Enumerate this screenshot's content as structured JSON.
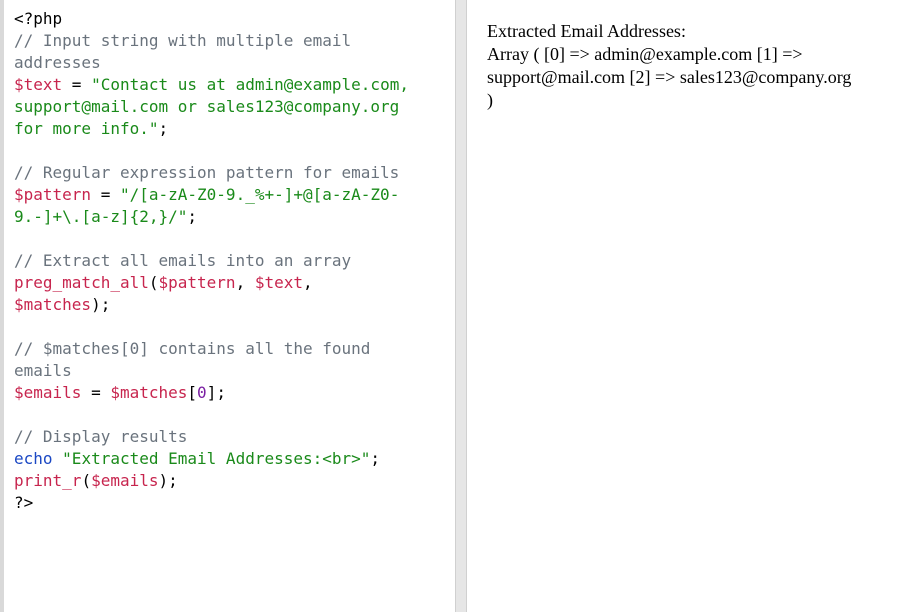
{
  "code_lines": [
    [
      {
        "t": "<?php",
        "c": "plain"
      }
    ],
    [
      {
        "t": "// Input string with multiple email",
        "c": "comment"
      }
    ],
    [
      {
        "t": "addresses",
        "c": "comment"
      }
    ],
    [
      {
        "t": "$text",
        "c": "var"
      },
      {
        "t": " = ",
        "c": "plain"
      },
      {
        "t": "\"Contact us at admin@example.com,",
        "c": "string"
      }
    ],
    [
      {
        "t": "support@mail.com or sales123@company.org",
        "c": "string"
      }
    ],
    [
      {
        "t": "for more info.\"",
        "c": "string"
      },
      {
        "t": ";",
        "c": "plain"
      }
    ],
    [],
    [
      {
        "t": "// Regular expression pattern for emails",
        "c": "comment"
      }
    ],
    [
      {
        "t": "$pattern",
        "c": "var"
      },
      {
        "t": " = ",
        "c": "plain"
      },
      {
        "t": "\"/[a-zA-Z0-9._%+-]+@[a-zA-Z0-",
        "c": "string"
      }
    ],
    [
      {
        "t": "9.-]+\\.[a-z]{2,}/\"",
        "c": "string"
      },
      {
        "t": ";",
        "c": "plain"
      }
    ],
    [],
    [
      {
        "t": "// Extract all emails into an array",
        "c": "comment"
      }
    ],
    [
      {
        "t": "preg_match_all",
        "c": "func"
      },
      {
        "t": "(",
        "c": "plain"
      },
      {
        "t": "$pattern",
        "c": "var"
      },
      {
        "t": ", ",
        "c": "plain"
      },
      {
        "t": "$text",
        "c": "var"
      },
      {
        "t": ",",
        "c": "plain"
      }
    ],
    [
      {
        "t": "$matches",
        "c": "var"
      },
      {
        "t": ");",
        "c": "plain"
      }
    ],
    [],
    [
      {
        "t": "// $matches[0] contains all the found",
        "c": "comment"
      }
    ],
    [
      {
        "t": "emails",
        "c": "comment"
      }
    ],
    [
      {
        "t": "$emails",
        "c": "var"
      },
      {
        "t": " = ",
        "c": "plain"
      },
      {
        "t": "$matches",
        "c": "var"
      },
      {
        "t": "[",
        "c": "plain"
      },
      {
        "t": "0",
        "c": "number"
      },
      {
        "t": "];",
        "c": "plain"
      }
    ],
    [],
    [
      {
        "t": "// Display results",
        "c": "comment"
      }
    ],
    [
      {
        "t": "echo",
        "c": "keyword"
      },
      {
        "t": " ",
        "c": "plain"
      },
      {
        "t": "\"Extracted Email Addresses:<br>\"",
        "c": "string"
      },
      {
        "t": ";",
        "c": "plain"
      }
    ],
    [
      {
        "t": "print_r",
        "c": "func"
      },
      {
        "t": "(",
        "c": "plain"
      },
      {
        "t": "$emails",
        "c": "var"
      },
      {
        "t": ");",
        "c": "plain"
      }
    ],
    [
      {
        "t": "?>",
        "c": "plain"
      }
    ]
  ],
  "output": {
    "lines": [
      "Extracted Email Addresses:",
      "Array ( [0] => admin@example.com [1] =>",
      "support@mail.com [2] => sales123@company.org",
      ")"
    ]
  },
  "colors": {
    "comment": "#6a737d",
    "variable": "#c7254e",
    "string": "#1a8a1a",
    "keyword": "#1b48c4",
    "number": "#7a1fa2"
  }
}
